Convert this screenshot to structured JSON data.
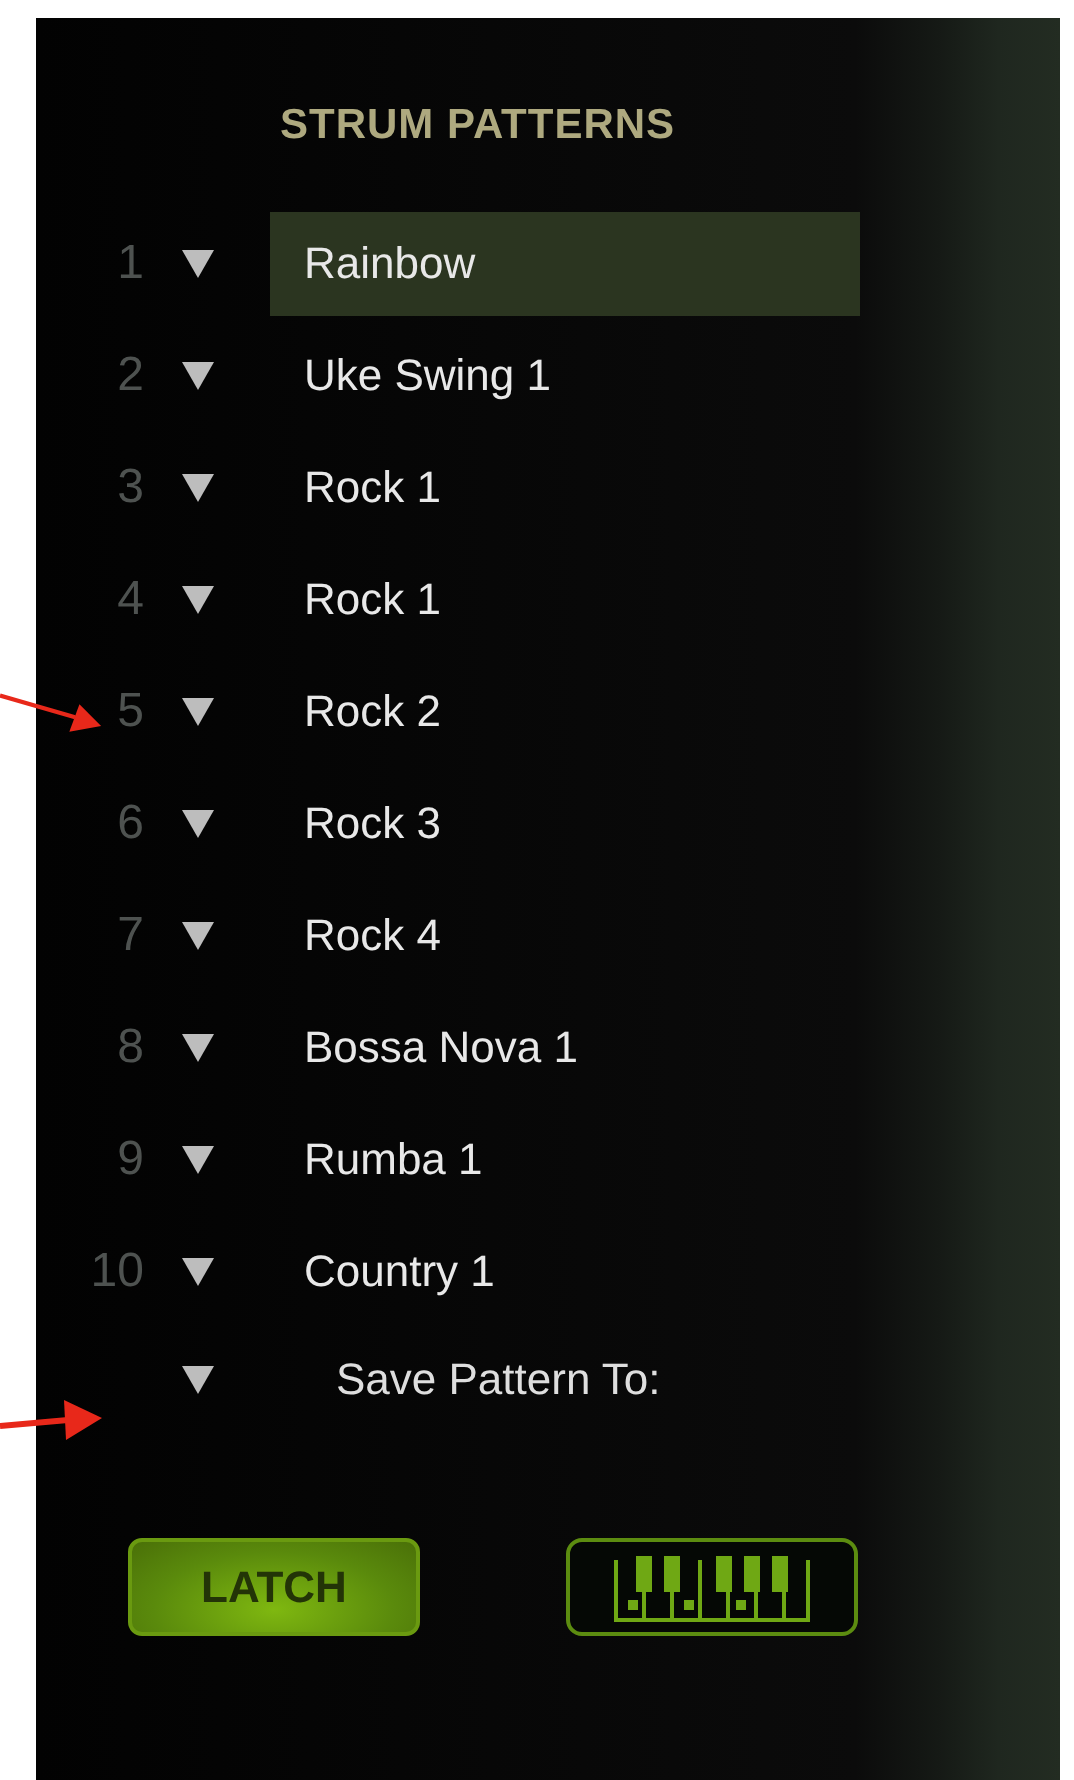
{
  "panel": {
    "title": "STRUM PATTERNS"
  },
  "patterns": [
    {
      "number": "1",
      "name": "Rainbow",
      "selected": true
    },
    {
      "number": "2",
      "name": "Uke Swing 1",
      "selected": false
    },
    {
      "number": "3",
      "name": "Rock 1",
      "selected": false
    },
    {
      "number": "4",
      "name": "Rock 1",
      "selected": false
    },
    {
      "number": "5",
      "name": "Rock 2",
      "selected": false
    },
    {
      "number": "6",
      "name": "Rock 3",
      "selected": false
    },
    {
      "number": "7",
      "name": "Rock 4",
      "selected": false
    },
    {
      "number": "8",
      "name": "Bossa Nova 1",
      "selected": false
    },
    {
      "number": "9",
      "name": "Rumba 1",
      "selected": false
    },
    {
      "number": "10",
      "name": "Country 1",
      "selected": false
    }
  ],
  "save": {
    "label": "Save Pattern To:"
  },
  "latch": {
    "label": "LATCH",
    "on": true
  },
  "keyboard_button": {
    "on": false
  }
}
